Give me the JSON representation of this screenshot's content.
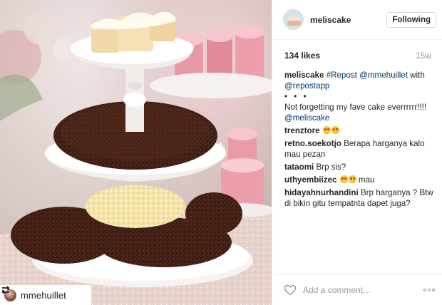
{
  "repost": {
    "username": "mmehuillet",
    "repost_icon": "repost-arrows-icon"
  },
  "post": {
    "account": "meliscake",
    "follow_label": "Following",
    "likes": "134 likes",
    "age": "15w",
    "caption": {
      "username": "meliscake",
      "hashtag": "#Repost",
      "mention": "@mmehuillet",
      "with": "with",
      "via": "@repostapp",
      "dots": "• • •",
      "text": "Not forgetting my fave cake everrrrrr!!!!",
      "mention2": "@meliscake"
    },
    "comments": [
      {
        "user": "trenztore",
        "text": "",
        "emojis": 2
      },
      {
        "user": "retno.soekotjo",
        "text": "Berapa harganya kalo mau pezan",
        "emojis": 0
      },
      {
        "user": "tataomi",
        "text": "Brp sis?",
        "emojis": 0
      },
      {
        "user": "uthyembiizec",
        "text": "mau",
        "emojis": 2
      },
      {
        "user": "hidayahnurhandini",
        "text": "Brp harganya ? Btw di bikin gitu tempatnta dapet juga?",
        "emojis": 0
      }
    ],
    "add_comment_placeholder": "Add a comment…",
    "icons": {
      "like": "heart-outline-icon",
      "more": "more-options-icon"
    }
  }
}
